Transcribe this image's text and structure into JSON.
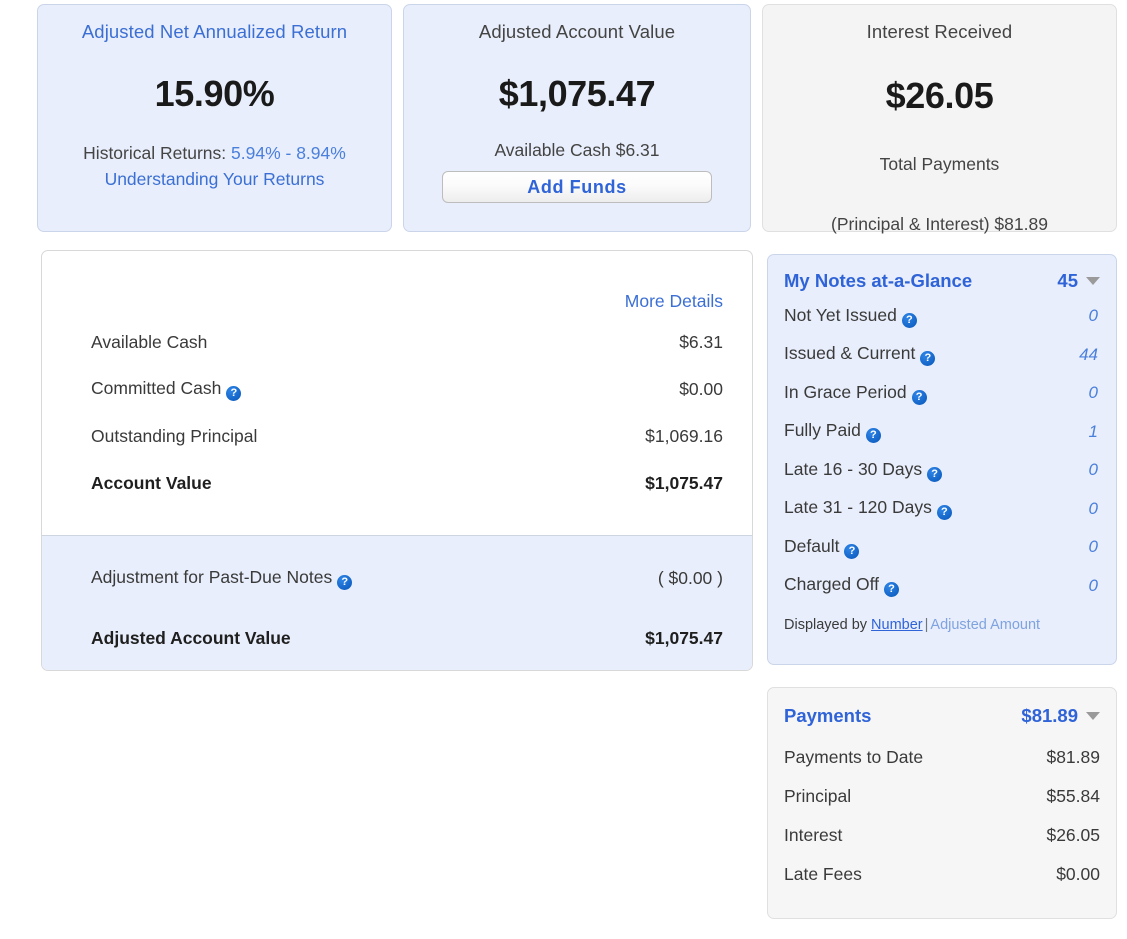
{
  "summary_cards": [
    {
      "id": "adjusted-net-annualized-return",
      "title": "Adjusted Net Annualized Return",
      "amount": "15.90%",
      "sub_prefix": "Historical Returns:",
      "sub_value": "5.94% - 8.94%",
      "link": "Understanding Your Returns",
      "accent": "#3b6fd4",
      "background": "#e8eefb"
    },
    {
      "id": "adjusted-account-value",
      "title": "Adjusted Account Value",
      "amount": "$1,075.47",
      "sub": "Available Cash $6.31",
      "button": "Add Funds",
      "accent": "#2f63d8",
      "background": "#e8eefb"
    },
    {
      "id": "interest-received",
      "title": "Interest Received",
      "amount": "$26.05",
      "sub_line1": "Total Payments",
      "sub_line2": "(Principal & Interest) $81.89",
      "background": "#f4f4f4"
    }
  ],
  "account_panel": {
    "more_details": "More Details",
    "rows": [
      {
        "label": "Available Cash",
        "amount": "$6.31",
        "help": false,
        "bold": false
      },
      {
        "label": "Committed Cash",
        "amount": "$0.00",
        "help": true,
        "bold": false
      },
      {
        "label": "Outstanding Principal",
        "amount": "$1,069.16",
        "help": false,
        "bold": false
      },
      {
        "label": "Account Value",
        "amount": "$1,075.47",
        "help": false,
        "bold": true
      }
    ],
    "adjustment_rows": [
      {
        "label": "Adjustment for Past-Due Notes",
        "amount": "( $0.00 )",
        "help": true,
        "bold": false
      },
      {
        "label": "Adjusted Account Value",
        "amount": "$1,075.47",
        "help": false,
        "bold": true
      }
    ]
  },
  "notes_panel": {
    "title": "My Notes at-a-Glance",
    "total": "45",
    "rows": [
      {
        "label": "Not Yet Issued",
        "value": "0",
        "help": true
      },
      {
        "label": "Issued & Current",
        "value": "44",
        "help": true
      },
      {
        "label": "In Grace Period",
        "value": "0",
        "help": true
      },
      {
        "label": "Fully Paid",
        "value": "1",
        "help": true
      },
      {
        "label": "Late 16 - 30 Days",
        "value": "0",
        "help": true
      },
      {
        "label": "Late 31 - 120 Days",
        "value": "0",
        "help": true
      },
      {
        "label": "Default",
        "value": "0",
        "help": true
      },
      {
        "label": "Charged Off",
        "value": "0",
        "help": true
      }
    ],
    "displayed_by_prefix": "Displayed by",
    "displayed_by_active": "Number",
    "displayed_by_separator": "|",
    "displayed_by_alt": "Adjusted Amount"
  },
  "payments_panel": {
    "title": "Payments",
    "total": "$81.89",
    "rows": [
      {
        "label": "Payments to Date",
        "value": "$81.89"
      },
      {
        "label": "Principal",
        "value": "$55.84"
      },
      {
        "label": "Interest",
        "value": "$26.05"
      },
      {
        "label": "Late Fees",
        "value": "$0.00"
      }
    ]
  },
  "icons": {
    "help": "?",
    "caret_down": "caret-down-icon"
  }
}
